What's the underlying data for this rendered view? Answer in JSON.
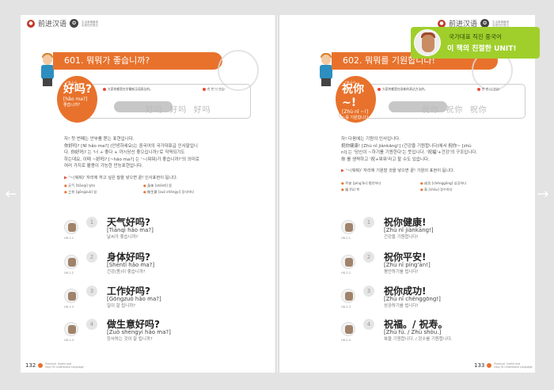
{
  "header": {
    "title": "前进汉语",
    "sub": "生活事情最常出现在的表达"
  },
  "nav": {
    "prev_icon": "arrow-left-icon",
    "next_icon": "arrow-right-icon"
  },
  "promo": {
    "line1": "국가대표 직진 중국어",
    "line2": "이 책의 친절한 UNIT!"
  },
  "left": {
    "banner": "601. 뭐뭐가 좋습니까?",
    "tip_box": "大家的都是在学最新汉语表达的。",
    "tip_tag": "한 번 더 연습!",
    "word_cn": "好吗?",
    "word_py": "[hǎo ma?]",
    "word_ko": "좋습니까?",
    "unit_code": "U6-1-0",
    "repeat": [
      "好吗",
      "好吗",
      "好吗"
    ],
    "body": [
      "자! 첫 번째는 안부를 묻는 표현입니다.",
      "你好吗? [Nǐ hǎo ma?] (안녕하세요)는 중국어의 국가대표급 인사말입니",
      "다. 你好吗? 는 '너 + 좋다 + 까?(당신 좋으십니까)'로 직역되기도",
      "하는데요, 이때 ~好吗? [~hǎo ma?] 는 '~(뭐뭐)가 좋습니까?'의 의미로",
      "여러 가지로 활용이 가능한 만능표현입니다."
    ],
    "note": "'~(뭐뭐)' 자리에 하고 싶은 말을 넣으면 끝! 인사표현이 됩니다.",
    "vocab": [
      "天气 [tiānqì] 날씨",
      "身体 [shēntǐ] 몸",
      "工作 [gōngzuò] 일",
      "做生意 [zuò shēngyi] 장사하다"
    ],
    "items": [
      {
        "num": "1",
        "cn": "天气好吗?",
        "py": "[Tiānqì hǎo ma?]",
        "ko": "날씨가 좋습니까?",
        "code": "U6-1-1"
      },
      {
        "num": "2",
        "cn": "身体好吗?",
        "py": "[Shēntǐ hǎo ma?]",
        "ko": "건강(몸)이 좋습니까?",
        "code": "U6-1-2"
      },
      {
        "num": "3",
        "cn": "工作好吗?",
        "py": "[Gōngzuò hǎo ma?]",
        "ko": "일이 잘 됩니까?",
        "code": "U6-1-3"
      },
      {
        "num": "4",
        "cn": "做生意好吗?",
        "py": "[Zuò shēngyi hǎo ma?]",
        "ko": "장사하는 것이 잘 됩니까?",
        "code": "U6-1-4"
      }
    ],
    "page_num": "132",
    "foot_text": [
      "Practical. Useful and",
      "Easy To Understand",
      "Language"
    ]
  },
  "right": {
    "banner": "602. 뭐뭐를 기원합니다!",
    "tip_box": "大家的都是在说新的表达方法的。",
    "tip_tag": "한 번 더 연습!",
    "word_cn": "祝你~!",
    "word_py": "[Zhù nǐ ~!]",
    "word_ko": "~를 기원합니다",
    "unit_code": "U6-2-0",
    "repeat": [
      "祝你",
      "祝你",
      "祝你"
    ],
    "body": [
      "자! 다음에는 기원의 인사입니다.",
      "祝你健康! [Zhù nǐ jiànkāng!] (건강을 기원합니다)에서 祝你~ [zhù",
      "nǐ] 는 '당신이 ~하기를 기원한다'는 뜻입니다. '祝福'+건강'의 구조입니다.",
      "你 를 생략하고 '祝+뭐뭐'라고 할 수도 있습니다."
    ],
    "note": "'~(뭐뭐)' 자리에 기원할 것을 넣으면 끝! 기원의 표현이 됩니다.",
    "vocab": [
      "平安 [píng'ān] 평안하다",
      "成功 [chénggōng] 성공하다",
      "福 [fú] 복",
      "寿 [shòu] 장수하다"
    ],
    "items": [
      {
        "num": "1",
        "cn": "祝你健康!",
        "py": "[Zhù nǐ jiànkāng!]",
        "ko": "건강을 기원합니다!",
        "code": "U6-2-1"
      },
      {
        "num": "2",
        "cn": "祝你平安!",
        "py": "[Zhù nǐ píng'ān!]",
        "ko": "평안하기를 빕니다!",
        "code": "U6-2-2"
      },
      {
        "num": "3",
        "cn": "祝你成功!",
        "py": "[Zhù nǐ chénggōng!]",
        "ko": "성공하기를 빕니다!",
        "code": "U6-2-3"
      },
      {
        "num": "4",
        "cn": "祝福。/ 祝寿。",
        "py": "[Zhù fú. / Zhù shòu.]",
        "ko": "복을 기원합니다. / 장수를 기원합니다.",
        "code": "U6-2-4"
      }
    ],
    "page_num": "133",
    "foot_text": [
      "Practical. Useful and",
      "Easy To Understand",
      "Language"
    ]
  }
}
